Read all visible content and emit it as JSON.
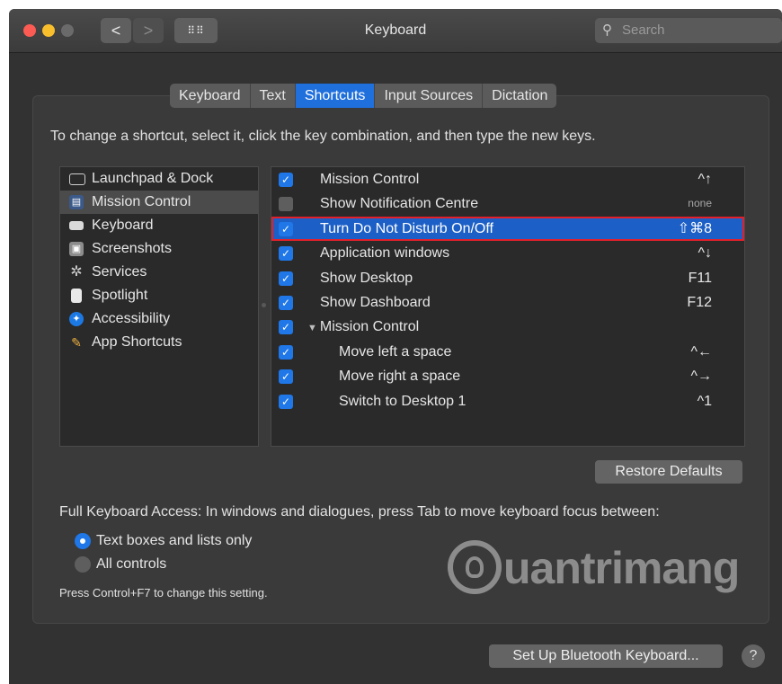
{
  "window": {
    "title": "Keyboard",
    "search_placeholder": "Search",
    "nav": {
      "back": "<",
      "forward": ">",
      "grid": "⠿⠿"
    }
  },
  "tabs": [
    {
      "label": "Keyboard",
      "active": false
    },
    {
      "label": "Text",
      "active": false
    },
    {
      "label": "Shortcuts",
      "active": true
    },
    {
      "label": "Input Sources",
      "active": false
    },
    {
      "label": "Dictation",
      "active": false
    }
  ],
  "instruction": "To change a shortcut, select it, click the key combination, and then type the new keys.",
  "categories": [
    {
      "label": "Launchpad & Dock",
      "icon": "launchpad-icon"
    },
    {
      "label": "Mission Control",
      "icon": "mission-control-icon",
      "selected": true
    },
    {
      "label": "Keyboard",
      "icon": "keyboard-icon"
    },
    {
      "label": "Screenshots",
      "icon": "screenshots-icon"
    },
    {
      "label": "Services",
      "icon": "gear-icon"
    },
    {
      "label": "Spotlight",
      "icon": "spotlight-icon"
    },
    {
      "label": "Accessibility",
      "icon": "accessibility-icon"
    },
    {
      "label": "App Shortcuts",
      "icon": "app-shortcuts-icon"
    }
  ],
  "shortcuts": [
    {
      "name": "Mission Control",
      "key": "^↑",
      "checked": true
    },
    {
      "name": "Show Notification Centre",
      "key": "none",
      "checked": false
    },
    {
      "name": "Turn Do Not Disturb On/Off",
      "key": "⇧⌘8",
      "checked": true,
      "selected": true
    },
    {
      "name": "Application windows",
      "key": "^↓",
      "checked": true
    },
    {
      "name": "Show Desktop",
      "key": "F11",
      "checked": true
    },
    {
      "name": "Show Dashboard",
      "key": "F12",
      "checked": true
    },
    {
      "name": "Mission Control",
      "key": "",
      "checked": true,
      "group": true,
      "triangle": "▼"
    },
    {
      "name": "Move left a space",
      "key": "^←",
      "checked": true,
      "sub": true
    },
    {
      "name": "Move right a space",
      "key": "^→",
      "checked": true,
      "sub": true
    },
    {
      "name": "Switch to Desktop 1",
      "key": "^1",
      "checked": true,
      "sub": true
    }
  ],
  "restore_defaults": "Restore Defaults",
  "full_keyboard_access": "Full Keyboard Access: In windows and dialogues, press Tab to move keyboard focus between:",
  "radio_options": [
    {
      "label": "Text boxes and lists only",
      "selected": true
    },
    {
      "label": "All controls",
      "selected": false
    }
  ],
  "note": "Press Control+F7 to change this setting.",
  "bluetooth_button": "Set Up Bluetooth Keyboard...",
  "help": "?",
  "watermark": "uantrimang",
  "colors": {
    "accent": "#1f77e8",
    "selection_outline": "#e3202a",
    "window_bg": "#323232"
  }
}
